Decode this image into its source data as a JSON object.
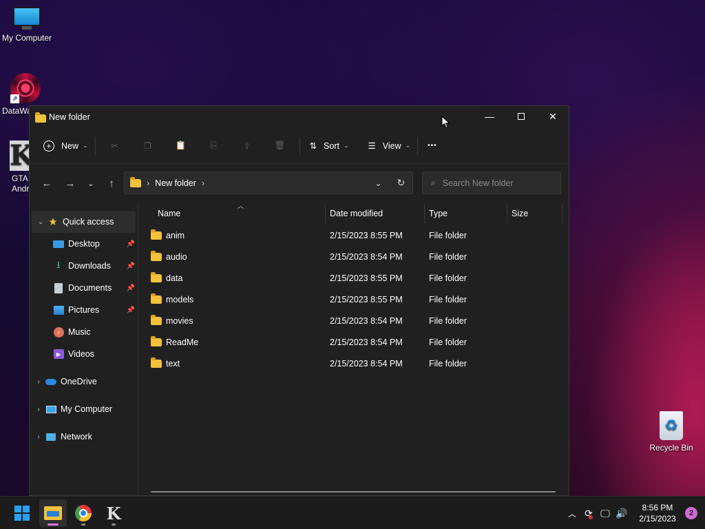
{
  "desktop": {
    "icons": [
      {
        "label": "My Computer"
      },
      {
        "label": "DataWa"
      },
      {
        "label": "GTA\nAndr"
      },
      {
        "label": "Recycle Bin"
      }
    ]
  },
  "window": {
    "title": "New folder",
    "command_bar": {
      "new_label": "New",
      "sort_label": "Sort",
      "view_label": "View",
      "more_label": "•••"
    },
    "address": {
      "path_segment": "New folder"
    },
    "search": {
      "placeholder": "Search New folder"
    },
    "sidebar": {
      "items": [
        {
          "label": "Quick access"
        },
        {
          "label": "Desktop"
        },
        {
          "label": "Downloads"
        },
        {
          "label": "Documents"
        },
        {
          "label": "Pictures"
        },
        {
          "label": "Music"
        },
        {
          "label": "Videos"
        },
        {
          "label": "OneDrive"
        },
        {
          "label": "My Computer"
        },
        {
          "label": "Network"
        }
      ]
    },
    "columns": {
      "name": "Name",
      "date": "Date modified",
      "type": "Type",
      "size": "Size"
    },
    "files": [
      {
        "name": "anim",
        "date": "2/15/2023 8:55 PM",
        "type": "File folder"
      },
      {
        "name": "audio",
        "date": "2/15/2023 8:54 PM",
        "type": "File folder"
      },
      {
        "name": "data",
        "date": "2/15/2023 8:55 PM",
        "type": "File folder"
      },
      {
        "name": "models",
        "date": "2/15/2023 8:55 PM",
        "type": "File folder"
      },
      {
        "name": "movies",
        "date": "2/15/2023 8:54 PM",
        "type": "File folder"
      },
      {
        "name": "ReadMe",
        "date": "2/15/2023 8:54 PM",
        "type": "File folder"
      },
      {
        "name": "text",
        "date": "2/15/2023 8:54 PM",
        "type": "File folder"
      }
    ]
  },
  "taskbar": {
    "time": "8:56 PM",
    "date": "2/15/2023",
    "notification_count": "2"
  },
  "colors": {
    "accent": "#2aa0f0",
    "folder": "#f3c23a",
    "window_bg": "#202020",
    "taskbar_bg": "#1c1c1c"
  }
}
